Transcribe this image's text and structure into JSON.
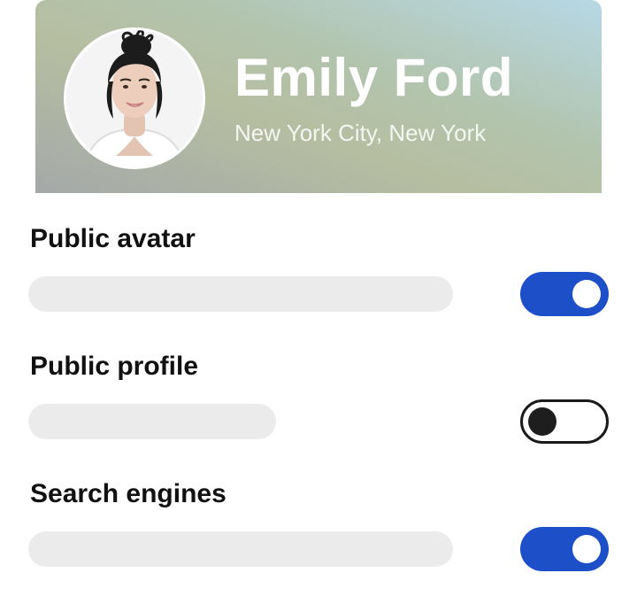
{
  "profile": {
    "name": "Emily Ford",
    "location": "New York City, New York"
  },
  "settings": [
    {
      "title": "Public avatar",
      "enabled": true
    },
    {
      "title": "Public profile",
      "enabled": false
    },
    {
      "title": "Search engines",
      "enabled": true
    }
  ],
  "colors": {
    "toggle_on": "#1c4fc8",
    "toggle_off_border": "#1a1a1a",
    "placeholder": "#ebebeb"
  }
}
